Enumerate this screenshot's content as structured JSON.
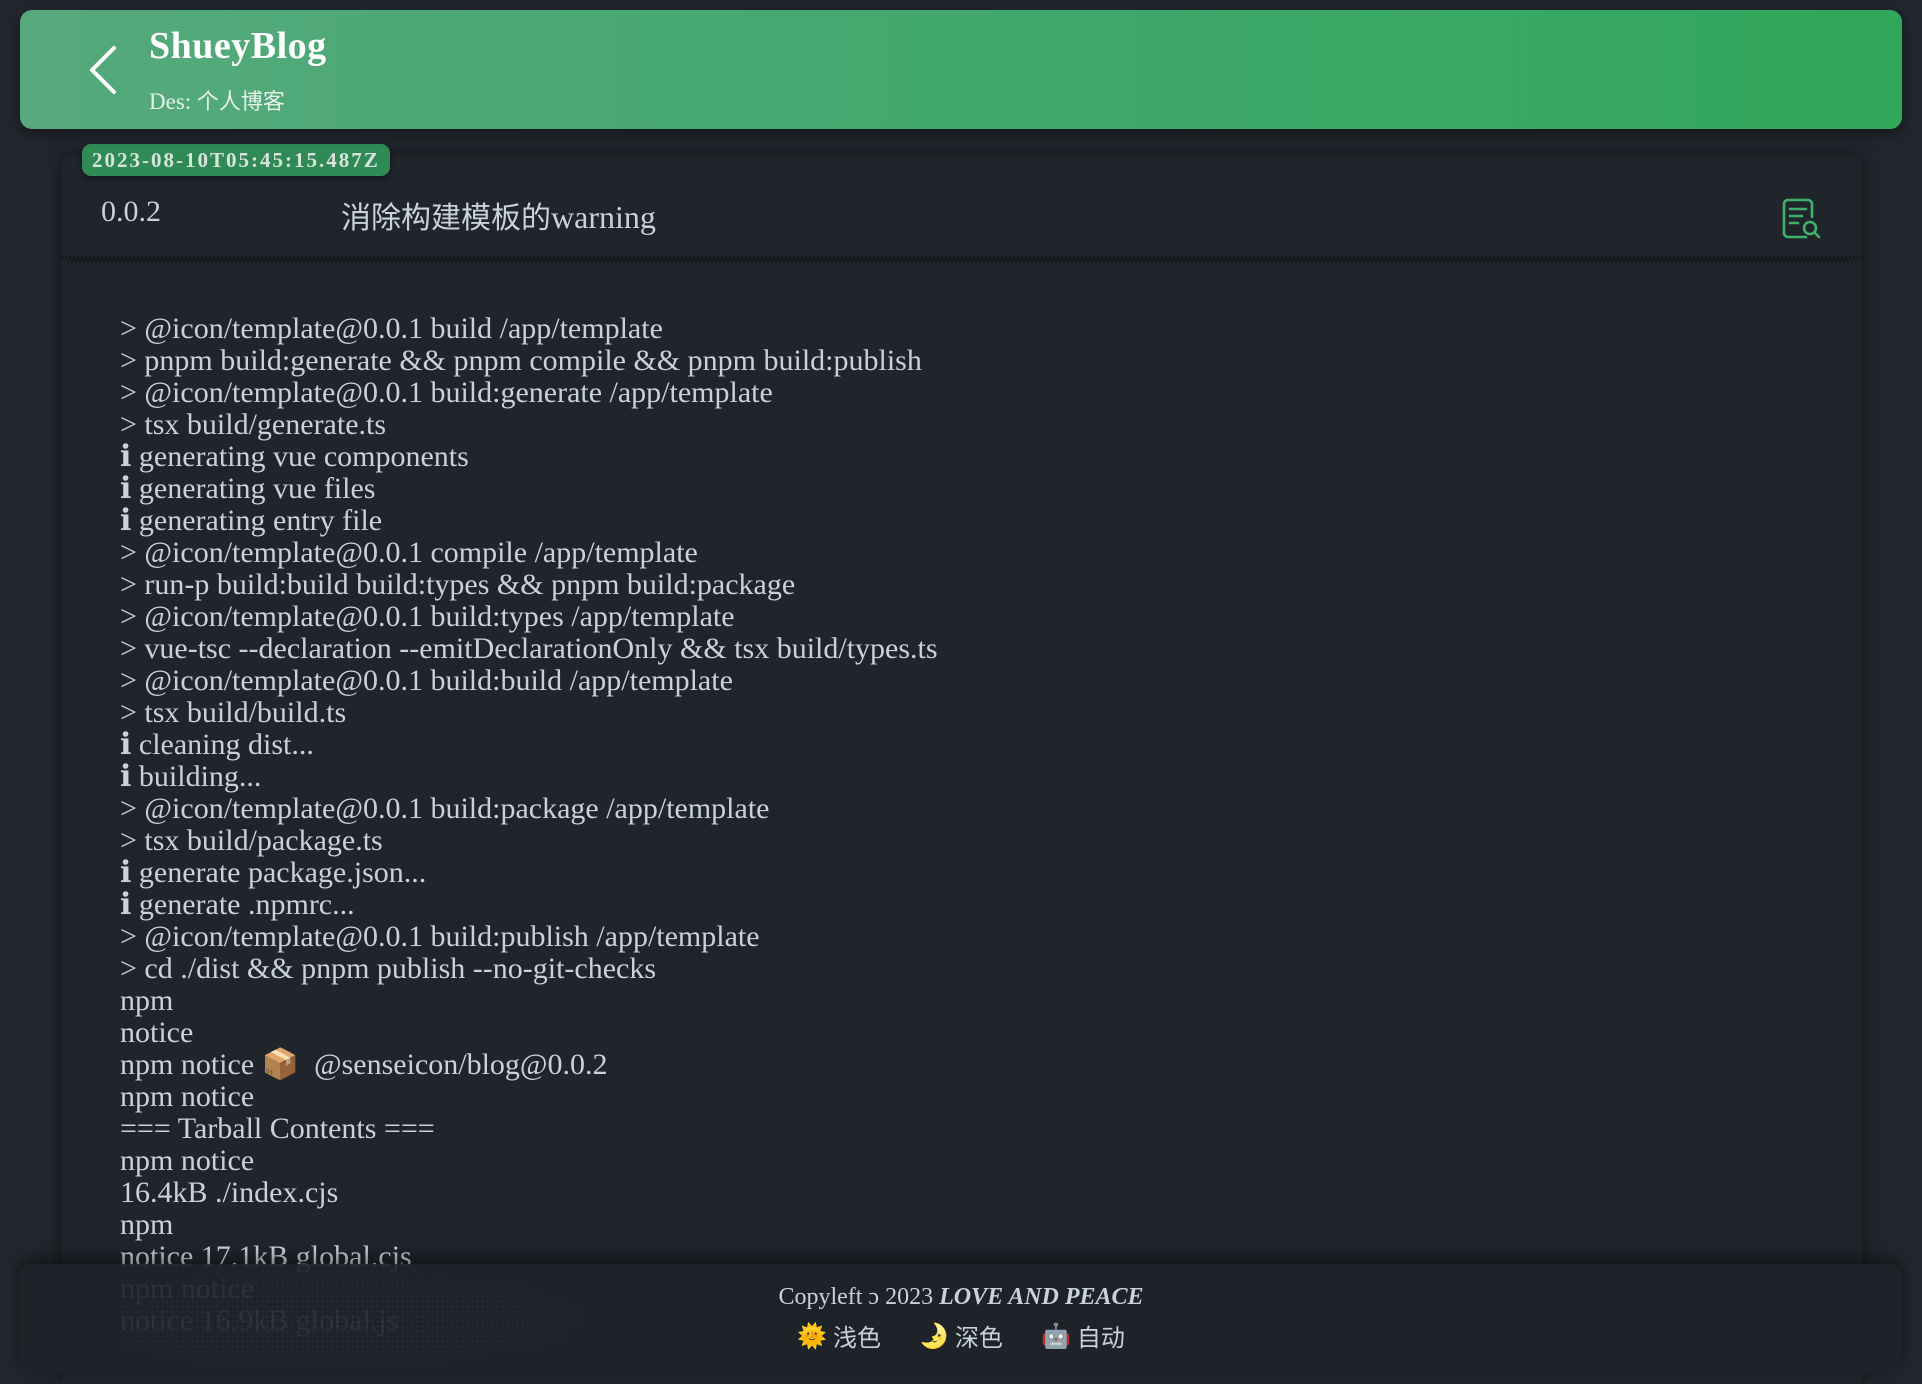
{
  "header": {
    "title": "ShueyBlog",
    "desc_label": "Des:",
    "desc_value": "个人博客",
    "colors": {
      "gradient_start": "#56a97c",
      "gradient_end": "#31a75a"
    }
  },
  "post": {
    "timestamp": "2023-08-10T05:45:15.487Z",
    "version": "0.0.2",
    "message_zh": "消除构建模板的",
    "message_en": "warning",
    "action_icon": "document-search-icon",
    "log_lines": [
      "> @icon/template@0.0.1 build /app/template",
      "> pnpm build:generate && pnpm compile && pnpm build:publish",
      "> @icon/template@0.0.1 build:generate /app/template",
      "> tsx build/generate.ts",
      "ℹ generating vue components",
      "ℹ generating vue files",
      "ℹ generating entry file",
      "> @icon/template@0.0.1 compile /app/template",
      "> run-p build:build build:types && pnpm build:package",
      "> @icon/template@0.0.1 build:types /app/template",
      "> vue-tsc --declaration --emitDeclarationOnly && tsx build/types.ts",
      "> @icon/template@0.0.1 build:build /app/template",
      "> tsx build/build.ts",
      "ℹ cleaning dist...",
      "ℹ building...",
      "> @icon/template@0.0.1 build:package /app/template",
      "> tsx build/package.ts",
      "ℹ generate package.json...",
      "ℹ generate .npmrc...",
      "> @icon/template@0.0.1 build:publish /app/template",
      "> cd ./dist && pnpm publish --no-git-checks",
      "npm",
      "notice",
      "npm notice 📦  @senseicon/blog@0.0.2",
      "npm notice",
      "=== Tarball Contents ===",
      "npm notice",
      "16.4kB ./index.cjs",
      "npm",
      "notice 17.1kB global.cjs",
      "npm notice",
      "notice 16.9kB global.js"
    ]
  },
  "footer": {
    "copyright_prefix": "Copyleft ɔ 2023 ",
    "copyright_motto": "LOVE AND PEACE",
    "themes": [
      {
        "emoji": "🌞",
        "label": "浅色"
      },
      {
        "emoji": "🌛",
        "label": "深色"
      },
      {
        "emoji": "🤖",
        "label": "自动"
      }
    ]
  }
}
